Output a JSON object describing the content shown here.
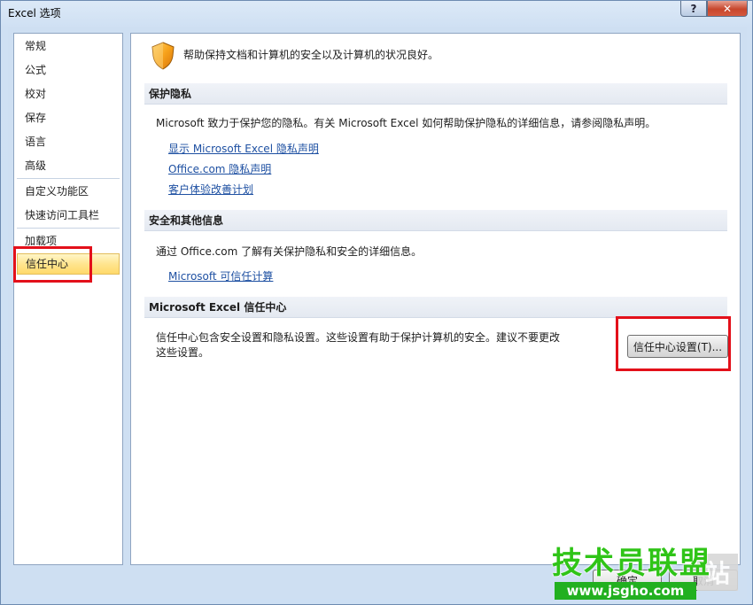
{
  "window": {
    "title": "Excel 选项",
    "help_label": "?",
    "close_label": "✕"
  },
  "sidebar": {
    "items": [
      {
        "label": "常规"
      },
      {
        "label": "公式"
      },
      {
        "label": "校对"
      },
      {
        "label": "保存"
      },
      {
        "label": "语言"
      },
      {
        "label": "高级"
      },
      {
        "label": "自定义功能区"
      },
      {
        "label": "快速访问工具栏"
      },
      {
        "label": "加载项"
      },
      {
        "label": "信任中心"
      }
    ],
    "selected": "信任中心"
  },
  "main": {
    "header": "帮助保持文档和计算机的安全以及计算机的状况良好。",
    "sections": [
      {
        "title": "保护隐私",
        "text": "Microsoft 致力于保护您的隐私。有关 Microsoft Excel 如何帮助保护隐私的详细信息，请参阅隐私声明。",
        "links": [
          "显示 Microsoft Excel 隐私声明",
          "Office.com 隐私声明",
          "客户体验改善计划"
        ]
      },
      {
        "title": "安全和其他信息",
        "text": "通过 Office.com 了解有关保护隐私和安全的详细信息。",
        "links": [
          "Microsoft 可信任计算"
        ]
      },
      {
        "title": "Microsoft Excel 信任中心",
        "text_line1": "信任中心包含安全设置和隐私设置。这些设置有助于保护计算机的安全。建议不要更改",
        "text_line2": "这些设置。",
        "button": "信任中心设置(T)..."
      }
    ]
  },
  "footer": {
    "ok_label": "确定",
    "cancel_label": "取消"
  },
  "watermark": {
    "main": "技术员联盟",
    "side": "站",
    "url": "www.jsgho.com"
  },
  "colors": {
    "highlight": "#e3101a",
    "link": "#1e50a2",
    "selected_bg": "#ffe58f"
  }
}
